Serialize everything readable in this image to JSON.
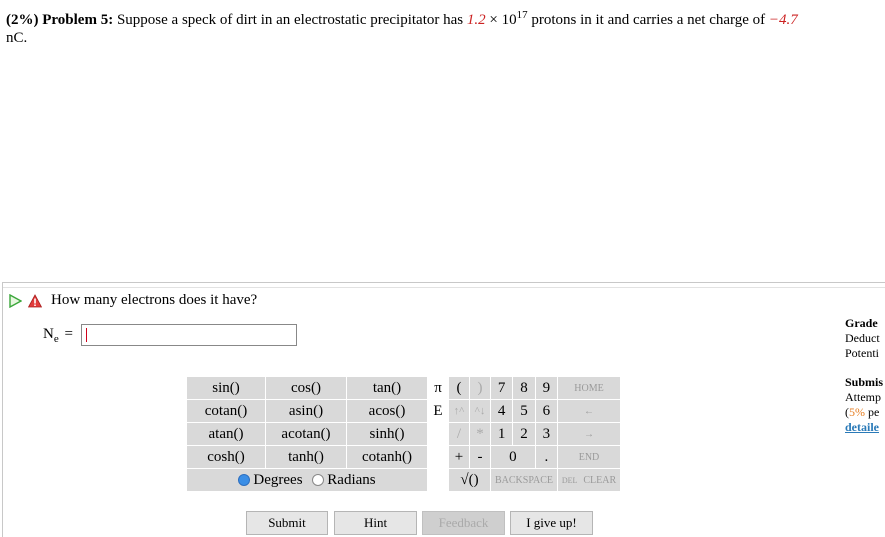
{
  "problem": {
    "percent": "(2%)",
    "number": "Problem 5:",
    "text_1": "Suppose a speck of dirt in an electrostatic precipitator has ",
    "value_1": "1.2",
    "text_2": " × 10",
    "exponent": "17",
    "text_3": " protons in it and carries a net charge of ",
    "value_2": "−4.7",
    "text_4": "nC."
  },
  "question": {
    "text": "How many electrons does it have?",
    "variable": "N",
    "variable_sub": "e",
    "equals": "=",
    "input_value": ""
  },
  "keypad": {
    "functions": [
      [
        "sin()",
        "cos()",
        "tan()"
      ],
      [
        "cotan()",
        "asin()",
        "acos()"
      ],
      [
        "atan()",
        "acotan()",
        "sinh()"
      ],
      [
        "cosh()",
        "tanh()",
        "cotanh()"
      ]
    ],
    "symbols": {
      "pi": "π",
      "lparen": "(",
      "rparen": ")",
      "E": "E",
      "up": "↑^",
      "down": "^↓",
      "divide": "/",
      "multiply": "*",
      "plus": "+",
      "minus": "-",
      "sqrt": "√()"
    },
    "digits": [
      "7",
      "8",
      "9",
      "4",
      "5",
      "6",
      "1",
      "2",
      "3",
      "0",
      "."
    ],
    "nav": {
      "home": "HOME",
      "left": "←",
      "right": "→",
      "end": "END",
      "backspace": "BACKSPACE",
      "del": "DEL",
      "clear": "CLEAR"
    },
    "modes": {
      "degrees": "Degrees",
      "radians": "Radians",
      "selected": "degrees"
    }
  },
  "buttons": {
    "submit": "Submit",
    "hint": "Hint",
    "feedback": "Feedback",
    "give_up": "I give up!"
  },
  "side_panel": {
    "grade": "Grade",
    "deduct": "Deduct",
    "potential": "Potenti",
    "submissions": "Submis",
    "attempts": "Attemp",
    "percent_open": "(",
    "percent_value": "5%",
    "percent_rest": " pe",
    "details": "detaile"
  },
  "colors": {
    "red_values": "#cc2222",
    "keypad_bg": "#d9d9d9",
    "accent_orange": "#e67e22",
    "link_blue": "#2a7ab8"
  }
}
